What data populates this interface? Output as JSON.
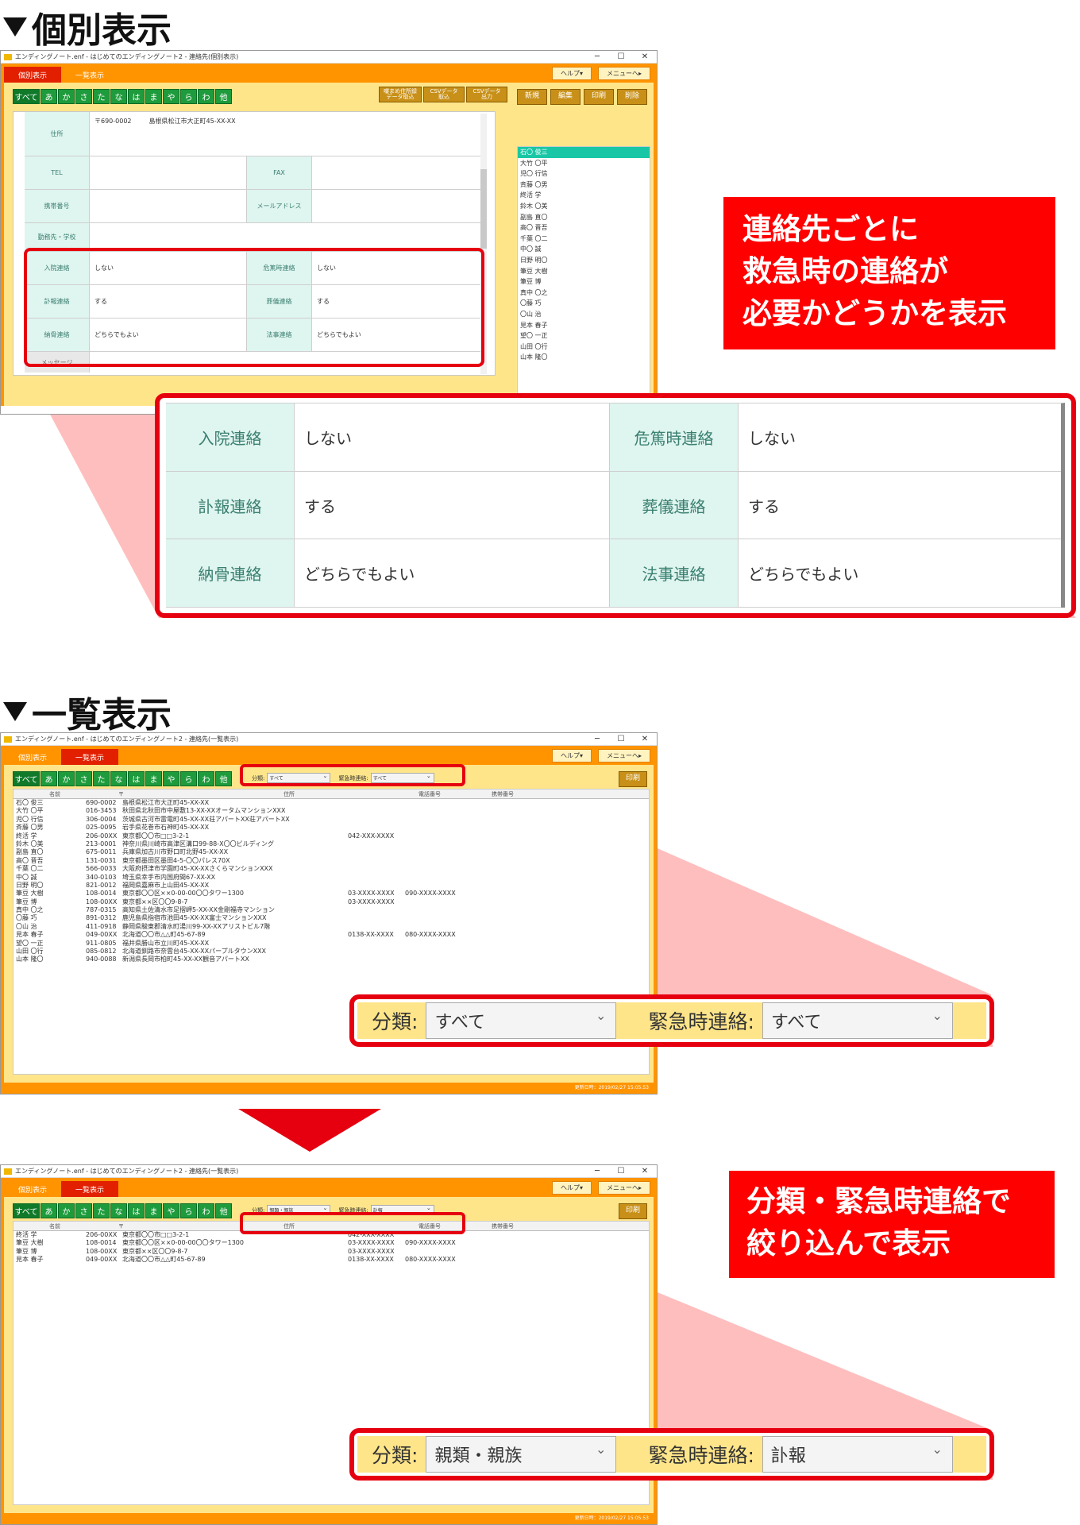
{
  "section1": {
    "heading": "個別表示"
  },
  "section2": {
    "heading": "一覧表示"
  },
  "window1": {
    "title": "エンディングノート.enf - はじめてのエンディングノート2 - 連絡先(個別表示)"
  },
  "window2": {
    "title": "エンディングノート.enf - はじめてのエンディングノート2 - 連絡先(一覧表示)"
  },
  "window3": {
    "title": "エンディングノート.enf - はじめてのエンディングノート2 - 連絡先(一覧表示)"
  },
  "window_controls": {
    "minimize": "─",
    "maximize": "☐",
    "close": "✕"
  },
  "tabs": {
    "individual": "個別表示",
    "list": "一覧表示"
  },
  "top_buttons": {
    "help": "ヘルプ▾",
    "menu": "メニューへ▸"
  },
  "kana_tabs": [
    "すべて",
    "あ",
    "か",
    "さ",
    "た",
    "な",
    "は",
    "ま",
    "や",
    "ら",
    "わ",
    "他"
  ],
  "tools": {
    "import_address_1": "囃まめ住所録",
    "import_address_2": "データ取込",
    "csv_import_1": "CSVデータ",
    "csv_import_2": "取込",
    "csv_export_1": "CSVデータ",
    "csv_export_2": "出力",
    "new": "新規",
    "edit": "編集",
    "print": "印刷",
    "delete": "削除"
  },
  "form": {
    "address_label": "住所",
    "zip": "〒690-0002",
    "address": "島根県松江市大正町45-XX-XX",
    "tel_label": "TEL",
    "fax_label": "FAX",
    "mobile_label": "携帯番号",
    "mail_label": "メールアドレス",
    "work_label": "勤務先・学校",
    "hospital_label": "入院連絡",
    "hospital_value": "しない",
    "critical_label": "危篤時連絡",
    "critical_value": "しない",
    "obituary_label": "訃報連絡",
    "obituary_value": "する",
    "funeral_label": "葬儀連絡",
    "funeral_value": "する",
    "bone_label": "納骨連絡",
    "bone_value": "どちらでもよい",
    "memorial_label": "法事連絡",
    "memorial_value": "どちらでもよい",
    "message_label": "メッセージ"
  },
  "name_list": [
    "石〇 俊三",
    "大竹 〇平",
    "児〇 行信",
    "斉藤 〇男",
    "終活 学",
    "鈴木 〇美",
    "副島 直〇",
    "高〇 晋吾",
    "千葉 〇二",
    "中〇 誠",
    "日野 明〇",
    "筆豆 大樹",
    "筆豆 博",
    "真中 〇之",
    "〇藤 巧",
    "〇山 治",
    "見本 春子",
    "望〇 一正",
    "山田 〇行",
    "山本 隆〇"
  ],
  "callout1": {
    "line1": "連絡先ごとに",
    "line2": "救急時の連絡が",
    "line3": "必要かどうかを表示"
  },
  "callout2": {
    "line1": "分類・緊急時連絡で",
    "line2": "絞り込んで表示"
  },
  "list_headers": {
    "name": "名前",
    "zip": "〒",
    "address": "住所",
    "phone": "電話番号",
    "mobile": "携帯番号"
  },
  "filter": {
    "category_label": "分類:",
    "emergency_label": "緊急時連絡:",
    "before_category": "すべて",
    "before_emergency": "すべて",
    "after_category": "親類・親族",
    "after_emergency": "訃報"
  },
  "list_rows_before": [
    {
      "name": "石〇 俊三",
      "zip": "690-0002",
      "address": "島根県松江市大正町45-XX-XX",
      "phone": "",
      "mobile": ""
    },
    {
      "name": "大竹 〇平",
      "zip": "016-3453",
      "address": "秋田県北秋田市中屋敷13-XX-XXオータムマンションXXX",
      "phone": "",
      "mobile": ""
    },
    {
      "name": "児〇 行信",
      "zip": "306-0004",
      "address": "茨城県古河市雷電町45-XX-XX荘アパートXX荘アパートXX",
      "phone": "",
      "mobile": ""
    },
    {
      "name": "斉藤 〇男",
      "zip": "025-0095",
      "address": "岩手県花巻市石神町45-XX-XX",
      "phone": "",
      "mobile": ""
    },
    {
      "name": "終活 学",
      "zip": "206-00XX",
      "address": "東京都〇〇市□□3-2-1",
      "phone": "042-XXX-XXXX",
      "mobile": ""
    },
    {
      "name": "鈴木 〇美",
      "zip": "213-0001",
      "address": "神奈川県川崎市高津区溝口99-88-X〇〇ビルディング",
      "phone": "",
      "mobile": ""
    },
    {
      "name": "副島 直〇",
      "zip": "675-0011",
      "address": "兵庫県加古川市野口町北野45-XX-XX",
      "phone": "",
      "mobile": ""
    },
    {
      "name": "高〇 晋吾",
      "zip": "131-0031",
      "address": "東京都墨田区墨田4-5-〇〇パレス70X",
      "phone": "",
      "mobile": ""
    },
    {
      "name": "千葉 〇二",
      "zip": "566-0033",
      "address": "大阪府摂津市学園町45-XX-XXさくらマンションXXX",
      "phone": "",
      "mobile": ""
    },
    {
      "name": "中〇 誠",
      "zip": "340-0103",
      "address": "埼玉県幸手市内国府間67-XX-XX",
      "phone": "",
      "mobile": ""
    },
    {
      "name": "日野 明〇",
      "zip": "821-0012",
      "address": "福岡県嘉麻市上山田45-XX-XX",
      "phone": "",
      "mobile": ""
    },
    {
      "name": "筆豆 大樹",
      "zip": "108-0014",
      "address": "東京都〇〇区××0-00-00〇〇タワー1300",
      "phone": "03-XXXX-XXXX",
      "mobile": "090-XXXX-XXXX"
    },
    {
      "name": "筆豆 博",
      "zip": "108-00XX",
      "address": "東京都××区〇〇9-8-7",
      "phone": "03-XXXX-XXXX",
      "mobile": ""
    },
    {
      "name": "真中 〇之",
      "zip": "787-0315",
      "address": "高知県土佐清水市足摺岬5-XX-XX金剛福寺マンション",
      "phone": "",
      "mobile": ""
    },
    {
      "name": "〇藤 巧",
      "zip": "891-0312",
      "address": "鹿児島県指宿市池田45-XX-XX富士マンションXXX",
      "phone": "",
      "mobile": ""
    },
    {
      "name": "〇山 治",
      "zip": "411-0918",
      "address": "静岡県駿東郡清水町湯川99-XX-XXアリストビル7階",
      "phone": "",
      "mobile": ""
    },
    {
      "name": "見本 春子",
      "zip": "049-00XX",
      "address": "北海道〇〇市△△町45-67-89",
      "phone": "0138-XX-XXXX",
      "mobile": "080-XXXX-XXXX"
    },
    {
      "name": "望〇 一正",
      "zip": "911-0805",
      "address": "福井県勝山市立川町45-XX-XX",
      "phone": "",
      "mobile": ""
    },
    {
      "name": "山田 〇行",
      "zip": "085-0812",
      "address": "北海道釧路市奈雲台45-XX-XXパープルタウンXXX",
      "phone": "",
      "mobile": ""
    },
    {
      "name": "山本 隆〇",
      "zip": "940-0088",
      "address": "新潟県長岡市柏町45-XX-XX観音アパートXX",
      "phone": "",
      "mobile": ""
    }
  ],
  "list_rows_after": [
    {
      "name": "終活 学",
      "zip": "206-00XX",
      "address": "東京都〇〇市□□3-2-1",
      "phone": "042-XXX-XXXX",
      "mobile": ""
    },
    {
      "name": "筆豆 大樹",
      "zip": "108-0014",
      "address": "東京都〇〇区××0-00-00〇〇タワー1300",
      "phone": "03-XXXX-XXXX",
      "mobile": "090-XXXX-XXXX"
    },
    {
      "name": "筆豆 博",
      "zip": "108-00XX",
      "address": "東京都××区〇〇9-8-7",
      "phone": "03-XXXX-XXXX",
      "mobile": ""
    },
    {
      "name": "見本 春子",
      "zip": "049-00XX",
      "address": "北海道〇〇市△△町45-67-89",
      "phone": "0138-XX-XXXX",
      "mobile": "080-XXXX-XXXX"
    }
  ],
  "status": {
    "updated": "更新日時：2019/02/27 15:05:53"
  },
  "colors": {
    "orange": "#ff9400",
    "red_tab": "#e22000",
    "green_tab": "#1e9b3c",
    "mint_label": "#dff5ef",
    "callout_red": "#ff0000"
  }
}
